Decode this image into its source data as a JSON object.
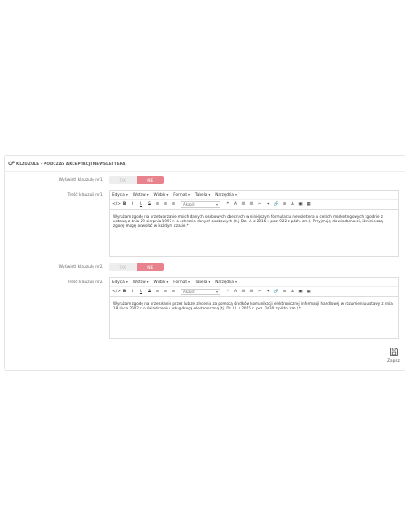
{
  "panel": {
    "title": "KLAUZULE - PODCZAS AKCEPTACJI NEWSLETTERA",
    "icon": "cogs-icon"
  },
  "clause1": {
    "show_label": "Wyświetl klauzulę nr1.",
    "toggle_yes": "TAK",
    "toggle_no": "NIE",
    "content_label": "Treść klauzuli nr1.",
    "text": "Wyrażam zgodę na przetwarzanie moich danych osobowych obecnych w niniejszym formularzu newslettera w celach marketingowych zgodnie z ustawą z dnia 29 sierpnia 1997 r. o ochronie danych osobowych (t.j. Dz. U. z 2016 r. poz. 922 z późn. zm.). Przyjmuję do wiadomości, iż niniejszą zgodę mogę odwołać w każdym czasie.*"
  },
  "clause2": {
    "show_label": "Wyświetl klauzulę nr2.",
    "toggle_yes": "TAK",
    "toggle_no": "NIE",
    "content_label": "Treść klauzuli nr2.",
    "text": "Wyrażam zgodę na przesyłanie przez lub ze zlecenia za pomocą środków komunikacji elektronicznej informacji handlowej w rozumieniu ustawy z dnia 18 lipca 2002 r. o świadczeniu usług drogą elektroniczną (tj. Dz. U. z 2016 r. poz. 1030 z późn. zm.).*"
  },
  "editor": {
    "menu": [
      "Edycja",
      "Wstaw",
      "Widok",
      "Format",
      "Tabela",
      "Narzędzia"
    ],
    "format_select": "Akapit"
  },
  "save": {
    "label": "Zapisz",
    "icon": "floppy-disk-icon"
  }
}
